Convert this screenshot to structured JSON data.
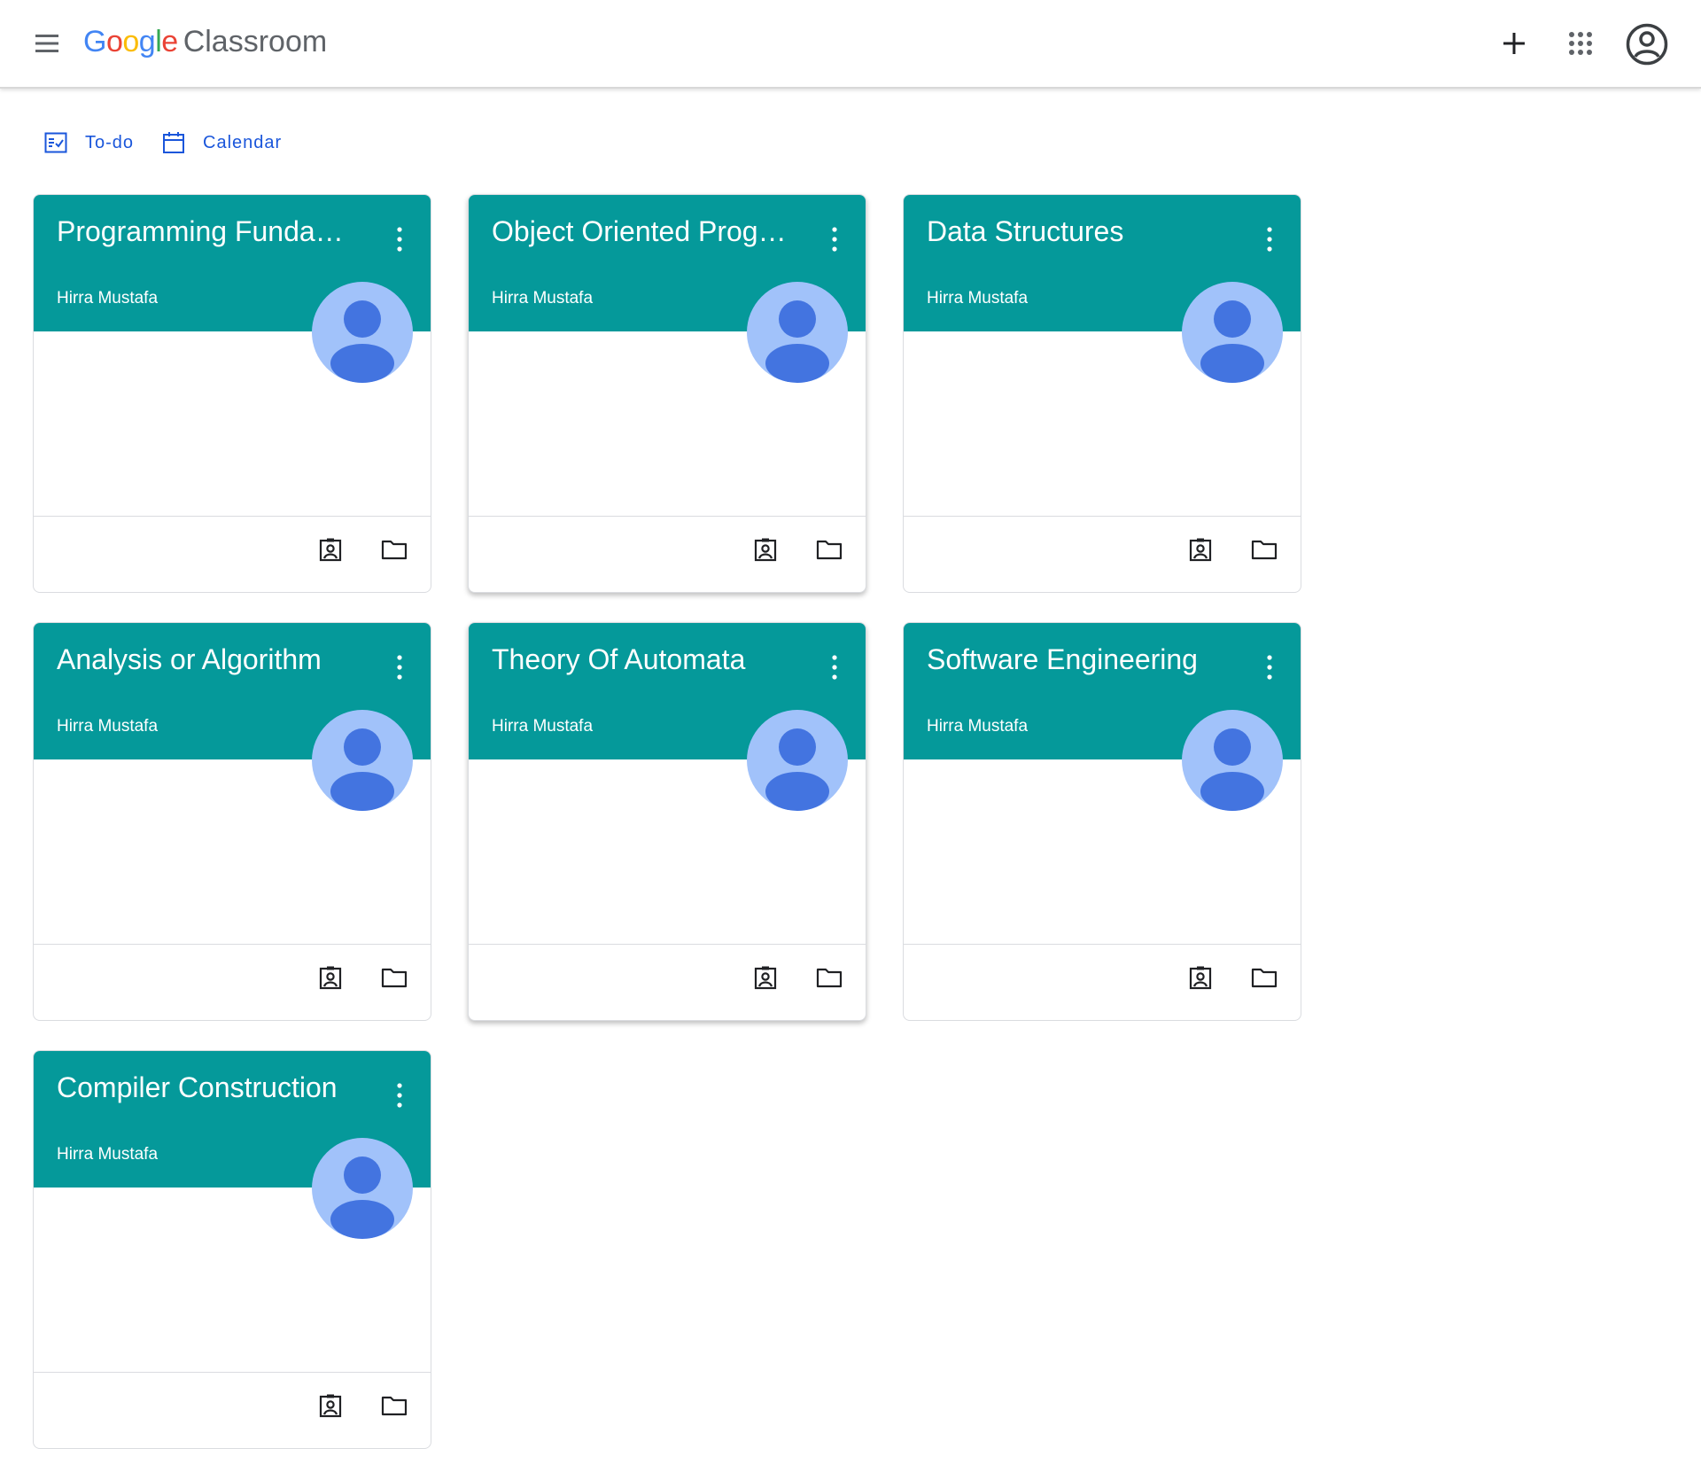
{
  "header": {
    "logo_brand_letters": [
      "G",
      "o",
      "o",
      "g",
      "l",
      "e"
    ],
    "logo_product": "Classroom",
    "icons": {
      "menu": "hamburger-menu-icon",
      "add": "plus-icon",
      "apps": "apps-grid-icon",
      "account": "account-circle-icon"
    }
  },
  "subnav": {
    "todo_label": "To-do",
    "calendar_label": "Calendar",
    "link_color": "#1a56db"
  },
  "colors": {
    "card_header": "#05999a",
    "avatar_bg": "#a1c2fa",
    "avatar_fg": "#4374e0",
    "google_blue": "#4285F4",
    "google_red": "#EA4335",
    "google_yellow": "#FBBC05",
    "google_green": "#34A853"
  },
  "classes": [
    {
      "title": "Programming Fundamentals",
      "owner": "Hirra Mustafa"
    },
    {
      "title": "Object Oriented Programming",
      "owner": "Hirra Mustafa"
    },
    {
      "title": "Data Structures",
      "owner": "Hirra Mustafa"
    },
    {
      "title": "Analysis or Algorithm",
      "owner": "Hirra Mustafa"
    },
    {
      "title": "Theory Of Automata",
      "owner": "Hirra Mustafa"
    },
    {
      "title": "Software Engineering",
      "owner": "Hirra Mustafa"
    },
    {
      "title": "Compiler Construction",
      "owner": "Hirra Mustafa"
    }
  ],
  "card_icons": {
    "menu": "more-vert-icon",
    "portfolio": "assignment-ind-icon",
    "folder": "folder-icon"
  }
}
